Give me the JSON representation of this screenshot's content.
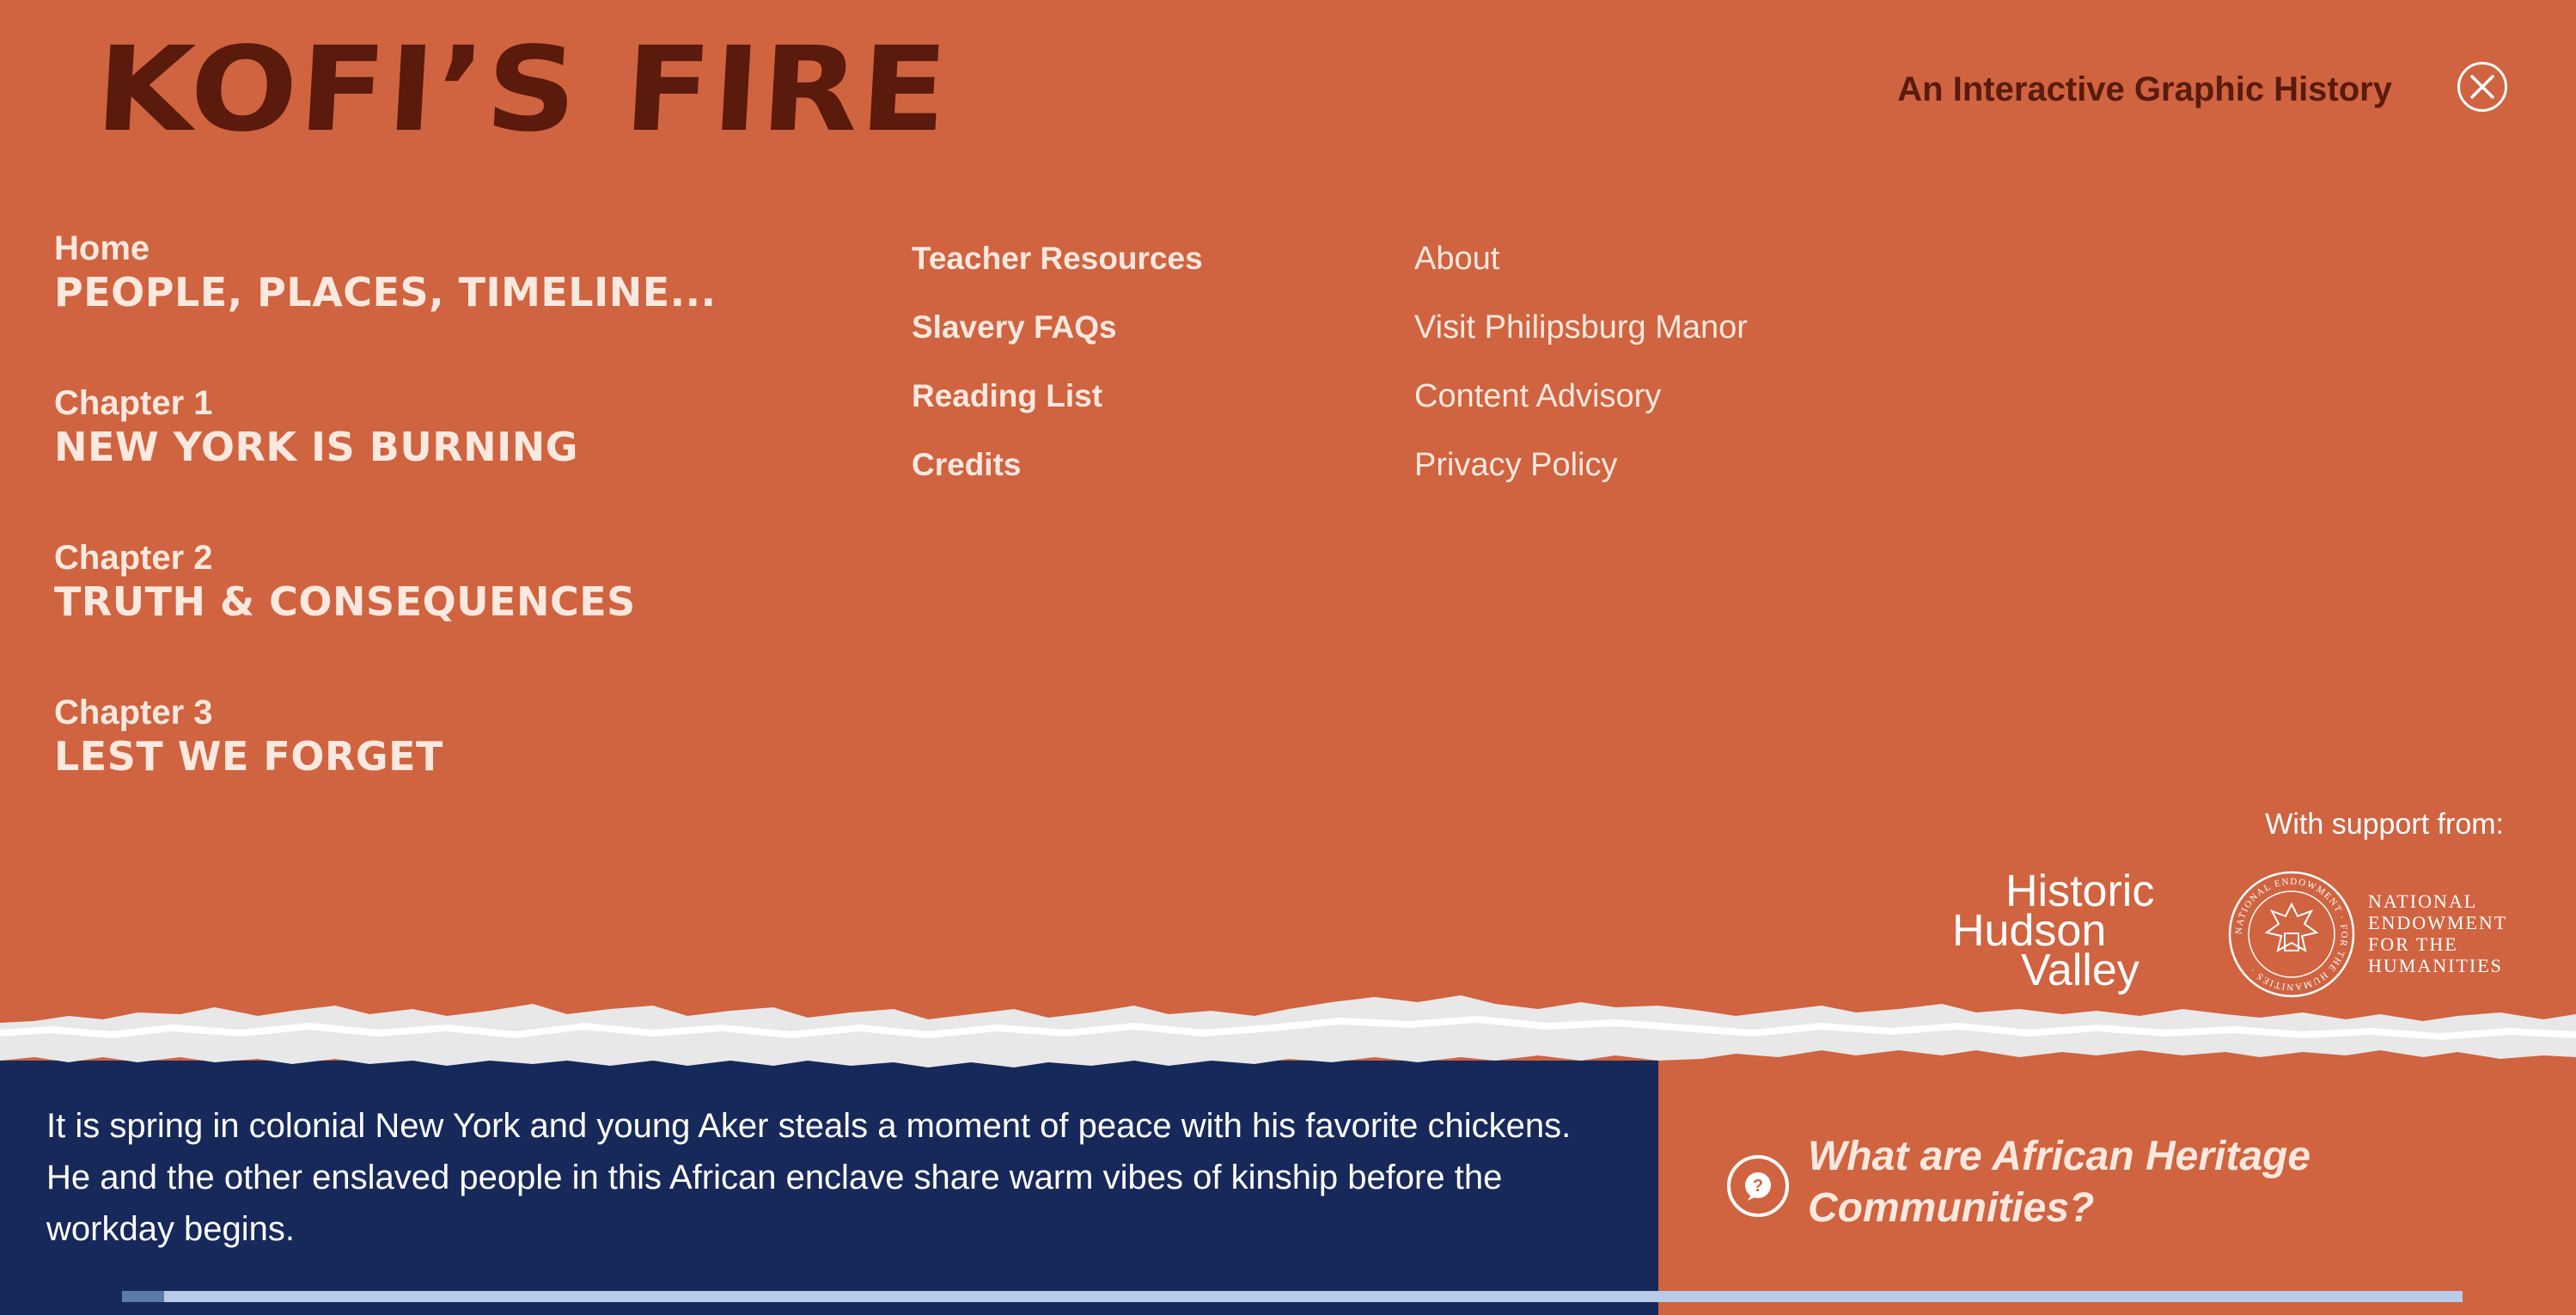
{
  "header": {
    "logo_text": "KOFI’S FIRE",
    "tagline": "An Interactive Graphic History",
    "close_icon": "close-icon"
  },
  "nav": {
    "primary": [
      {
        "sub": "Home",
        "title": "PEOPLE, PLACES, TIMELINE..."
      },
      {
        "sub": "Chapter 1",
        "title": "NEW YORK IS BURNING"
      },
      {
        "sub": "Chapter 2",
        "title": "TRUTH & CONSEQUENCES"
      },
      {
        "sub": "Chapter 3",
        "title": "LEST WE FORGET"
      }
    ],
    "secondary": [
      "Teacher Resources",
      "Slavery FAQs",
      "Reading List",
      "Credits"
    ],
    "tertiary": [
      "About",
      "Visit Philipsburg Manor",
      "Content Advisory",
      "Privacy Policy"
    ]
  },
  "support": {
    "label": "With support from:",
    "hhv": [
      "Historic",
      "Hudson",
      "Valley"
    ],
    "neh": [
      "NATIONAL",
      "ENDOWMENT",
      "FOR THE",
      "HUMANITIES"
    ],
    "neh_seal_text": "NATIONAL ENDOWMENT FOR THE HUMANITIES"
  },
  "story": {
    "text": "It is spring in colonial New York and young Aker steals a moment of peace with his favorite chickens. He and the other enslaved people in this African enclave share warm vibes of kinship before the workday begins."
  },
  "question": {
    "icon": "question-bubble-icon",
    "text": "What are African Heritage Communities?"
  },
  "progress": {
    "fraction": 0.018
  },
  "colors": {
    "background": "#d06340",
    "logo": "#5a1a0c",
    "story_panel": "#17295a",
    "nav_text": "#fbe8de"
  }
}
